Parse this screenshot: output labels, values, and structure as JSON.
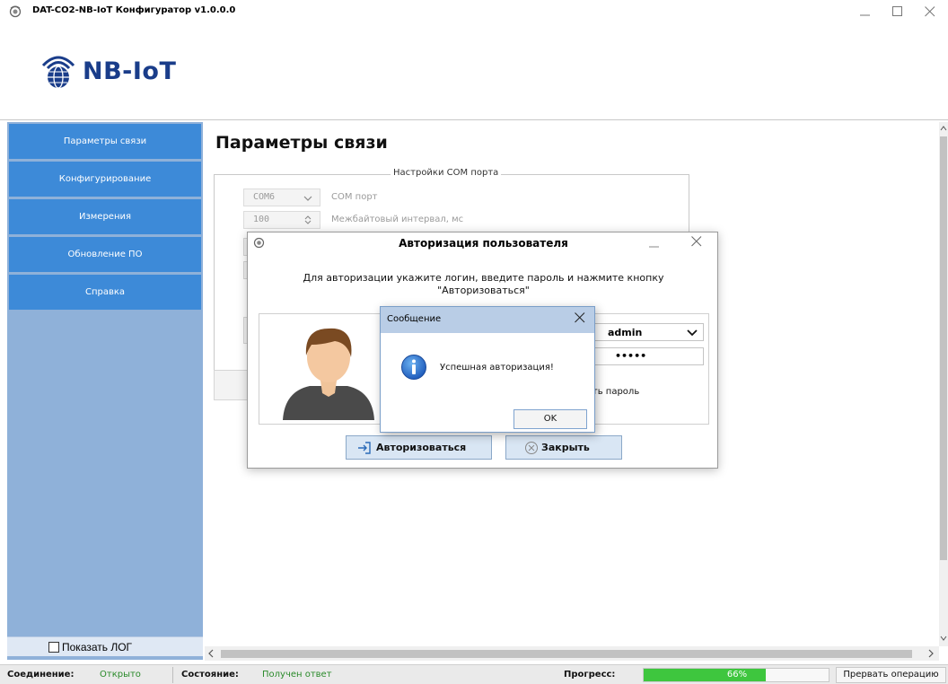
{
  "window": {
    "title": "DAT-CO2-NB-IoT Конфигуратор v1.0.0.0"
  },
  "logo": {
    "text": "NB-IoT"
  },
  "sidebar": {
    "items": [
      {
        "label": "Параметры связи"
      },
      {
        "label": "Конфигурирование"
      },
      {
        "label": "Измерения"
      },
      {
        "label": "Обновление ПО"
      },
      {
        "label": "Справка"
      }
    ],
    "show_log_label": "Показать ЛОГ"
  },
  "main": {
    "title": "Параметры связи",
    "com_group_title": "Настройки COM порта",
    "com_port_value": "COM6",
    "com_port_label": "COM порт",
    "interval_value": "100",
    "interval_label": "Межбайтовый интервал, мс"
  },
  "auth_dialog": {
    "title": "Авторизация пользователя",
    "message_line1": "Для авторизации укажите логин, введите пароль и нажмите кнопку",
    "message_line2": "\"Авторизоваться\"",
    "login_value": "admin",
    "password_mask": "•••••",
    "show_password_partial": "ыть пароль",
    "login_button": "Авторизоваться",
    "close_button": "Закрыть"
  },
  "message_box": {
    "title": "Сообщение",
    "text": "Успешная авторизация!",
    "ok_label": "OK"
  },
  "status": {
    "connection_key": "Соединение:",
    "connection_value": "Открыто",
    "state_key": "Состояние:",
    "state_value": "Получен ответ",
    "progress_key": "Прогресс:",
    "progress_fraction": 0.66,
    "progress_label": "66%",
    "abort_label": "Прервать операцию"
  },
  "colors": {
    "sidebar_item": "#3d8ad8",
    "sidebar_bg": "#8fb1d9",
    "status_value": "#2a8a2a",
    "progress_fill": "#3ec63e"
  }
}
